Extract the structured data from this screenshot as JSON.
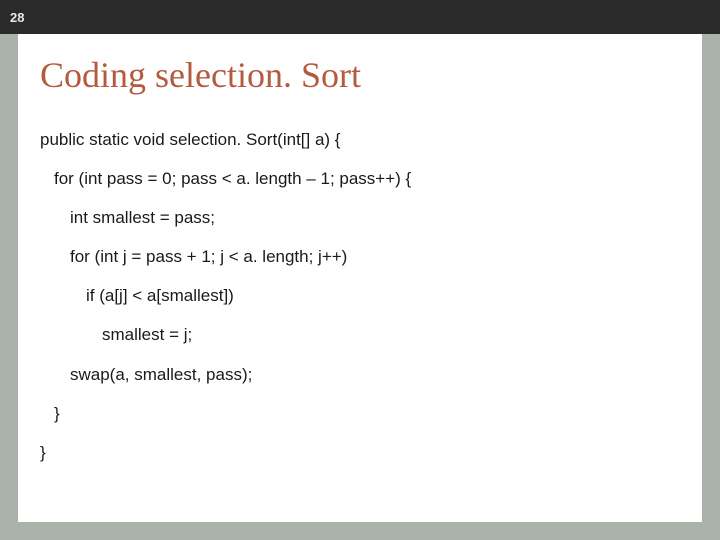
{
  "slide": {
    "number": "28",
    "title": "Coding selection. Sort",
    "code": {
      "line1": "public static void selection. Sort(int[] a) {",
      "line2": "for (int pass = 0; pass < a. length – 1; pass++) {",
      "line3": "int smallest = pass;",
      "line4": "for (int j = pass + 1; j < a. length; j++)",
      "line5": "if (a[j] < a[smallest])",
      "line6": "smallest = j;",
      "line7": "swap(a, smallest, pass);",
      "line8": "}",
      "line9": "}"
    }
  }
}
